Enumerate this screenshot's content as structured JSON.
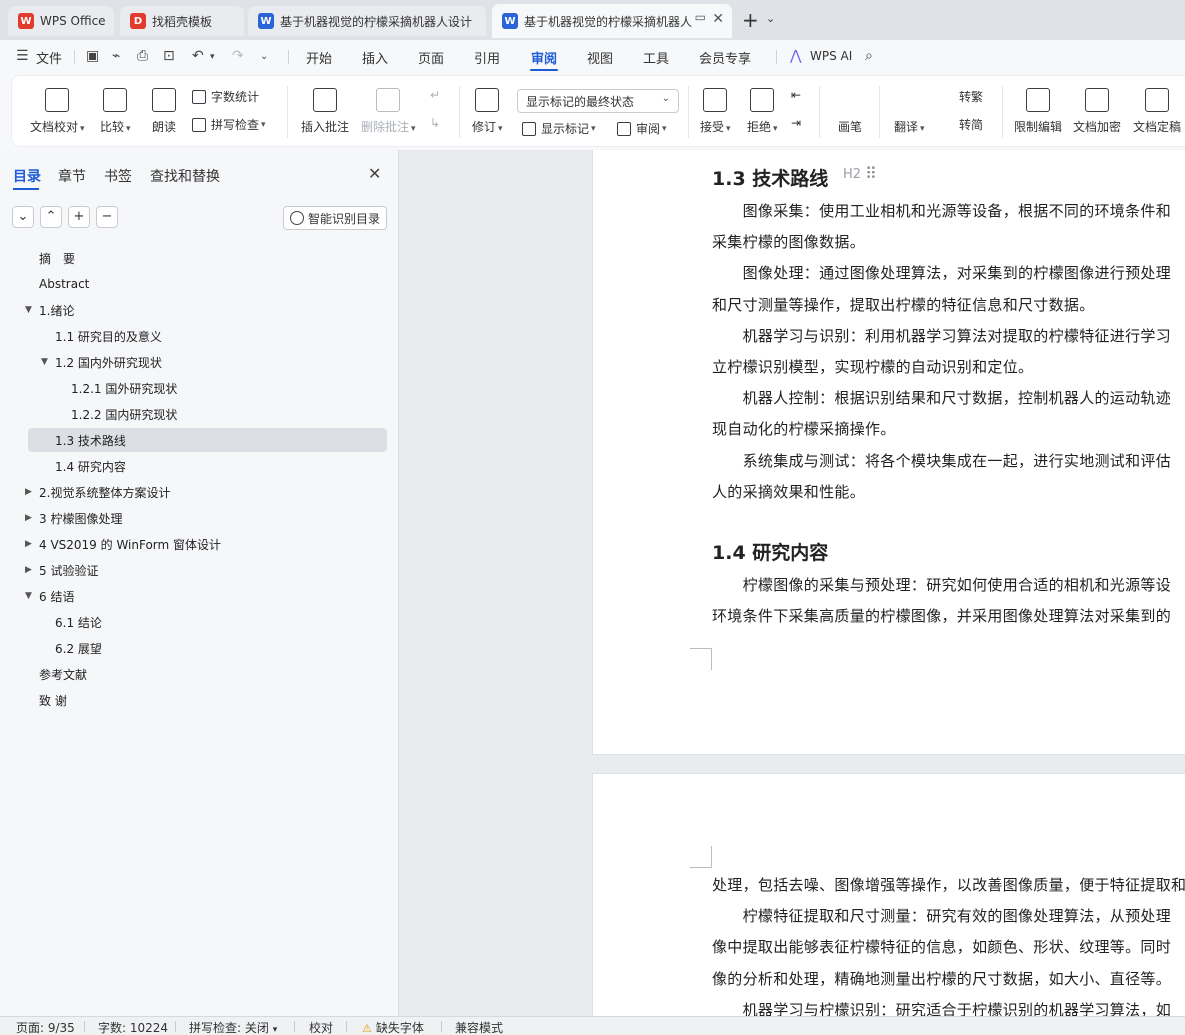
{
  "tabs": [
    {
      "label": "WPS Office",
      "logo_color": "#e23b2e",
      "logo_text": "W"
    },
    {
      "label": "找稻壳模板",
      "logo_color": "#e23b2e",
      "logo_text": "D"
    },
    {
      "label": "基于机器视觉的柠檬采摘机器人设计",
      "logo_color": "#2b63d9",
      "logo_text": "W"
    },
    {
      "label": "基于机器视觉的柠檬采摘机器人",
      "logo_color": "#2b63d9",
      "logo_text": "W"
    }
  ],
  "menu": {
    "file": "文件",
    "items": [
      "开始",
      "插入",
      "页面",
      "引用",
      "审阅",
      "视图",
      "工具",
      "会员专享"
    ],
    "active": "审阅",
    "wps_ai": "WPS AI"
  },
  "ribbon": {
    "doc_check": "文档校对",
    "compare": "比较",
    "read_aloud": "朗读",
    "word_count": "字数统计",
    "spell_check": "拼写检查",
    "insert_comment": "插入批注",
    "delete_comment": "删除批注",
    "revise": "修订",
    "markup_state": "显示标记的最终状态",
    "show_markup": "显示标记",
    "review": "审阅",
    "accept": "接受",
    "reject": "拒绝",
    "pen": "画笔",
    "translate": "翻译",
    "to_traditional": "转繁",
    "to_simplified": "转简",
    "restrict_edit": "限制编辑",
    "encrypt": "文档加密",
    "finalize": "文档定稿"
  },
  "sidebar": {
    "tabs": [
      "目录",
      "章节",
      "书签",
      "查找和替换"
    ],
    "smart_toc": "智能识别目录",
    "toc": [
      {
        "label": "摘　要",
        "level": 1,
        "arrow": ""
      },
      {
        "label": "Abstract",
        "level": 1,
        "arrow": ""
      },
      {
        "label": "1.绪论",
        "level": 1,
        "arrow": "down"
      },
      {
        "label": "1.1 研究目的及意义",
        "level": 2,
        "arrow": ""
      },
      {
        "label": "1.2 国内外研究现状",
        "level": 2,
        "arrow": "down"
      },
      {
        "label": "1.2.1 国外研究现状",
        "level": 3,
        "arrow": ""
      },
      {
        "label": "1.2.2 国内研究现状",
        "level": 3,
        "arrow": ""
      },
      {
        "label": "1.3  技术路线",
        "level": 2,
        "arrow": "",
        "selected": true
      },
      {
        "label": "1.4  研究内容",
        "level": 2,
        "arrow": ""
      },
      {
        "label": "2.视觉系统整体方案设计",
        "level": 1,
        "arrow": "right"
      },
      {
        "label": "3  柠檬图像处理",
        "level": 1,
        "arrow": "right"
      },
      {
        "label": "4 VS2019 的 WinForm 窗体设计",
        "level": 1,
        "arrow": "right"
      },
      {
        "label": "5  试验验证",
        "level": 1,
        "arrow": "right"
      },
      {
        "label": "6  结语",
        "level": 1,
        "arrow": "down"
      },
      {
        "label": "6.1  结论",
        "level": 2,
        "arrow": ""
      },
      {
        "label": "6.2  展望",
        "level": 2,
        "arrow": ""
      },
      {
        "label": "参考文献",
        "level": 1,
        "arrow": ""
      },
      {
        "label": "致  谢",
        "level": 1,
        "arrow": ""
      }
    ]
  },
  "document": {
    "heading_mark": "H2",
    "page1": {
      "heading_13": "1.3  技术路线",
      "lines_13": [
        "　　图像采集：使用工业相机和光源等设备，根据不同的环境条件和",
        "采集柠檬的图像数据。",
        "　　图像处理：通过图像处理算法，对采集到的柠檬图像进行预处理",
        "和尺寸测量等操作，提取出柠檬的特征信息和尺寸数据。",
        "　　机器学习与识别：利用机器学习算法对提取的柠檬特征进行学习",
        "立柠檬识别模型，实现柠檬的自动识别和定位。",
        "　　机器人控制：根据识别结果和尺寸数据，控制机器人的运动轨迹",
        "现自动化的柠檬采摘操作。",
        "　　系统集成与测试：将各个模块集成在一起，进行实地测试和评估",
        "人的采摘效果和性能。"
      ],
      "heading_14": "1.4  研究内容",
      "lines_14": [
        "　　柠檬图像的采集与预处理：研究如何使用合适的相机和光源等设",
        "环境条件下采集高质量的柠檬图像，并采用图像处理算法对采集到的"
      ]
    },
    "page2": {
      "lines": [
        "处理，包括去噪、图像增强等操作，以改善图像质量，便于特征提取和",
        "　　柠檬特征提取和尺寸测量：研究有效的图像处理算法，从预处理",
        "像中提取出能够表征柠檬特征的信息，如颜色、形状、纹理等。同时",
        "像的分析和处理，精确地测量出柠檬的尺寸数据，如大小、直径等。",
        "　　机器学习与柠檬识别：研究适合于柠檬识别的机器学习算法，如"
      ]
    }
  },
  "status": {
    "page": "页面: 9/35",
    "words": "字数: 10224",
    "spell": "拼写检查: 关闭",
    "proof": "校对",
    "missing_font": "缺失字体",
    "compat": "兼容模式"
  }
}
